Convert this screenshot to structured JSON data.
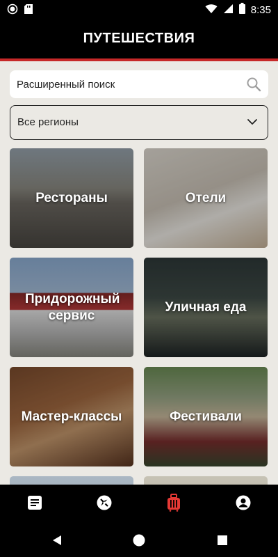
{
  "status_bar": {
    "time": "8:35",
    "icons": [
      "record-icon",
      "sd-card-icon",
      "wifi-icon",
      "cellular-icon",
      "battery-icon"
    ]
  },
  "header": {
    "title": "ПУТЕШЕСТВИЯ",
    "accent_color": "#c62828"
  },
  "search": {
    "placeholder": "Расширенный поиск",
    "icon": "search-icon"
  },
  "region_select": {
    "selected": "Все регионы",
    "icon": "chevron-down-icon"
  },
  "categories": [
    {
      "label": "Рестораны"
    },
    {
      "label": "Отели"
    },
    {
      "label": "Придорожный сервис"
    },
    {
      "label": "Уличная еда"
    },
    {
      "label": "Мастер-классы"
    },
    {
      "label": "Фестивали"
    }
  ],
  "bottom_nav": {
    "items": [
      {
        "icon": "news-icon",
        "active": false
      },
      {
        "icon": "compass-icon",
        "active": false
      },
      {
        "icon": "suitcase-icon",
        "active": true
      },
      {
        "icon": "profile-icon",
        "active": false
      }
    ],
    "active_color": "#e53935",
    "inactive_color": "#ffffff"
  },
  "system_nav": {
    "icons": [
      "back-icon",
      "home-icon",
      "recents-icon"
    ]
  }
}
